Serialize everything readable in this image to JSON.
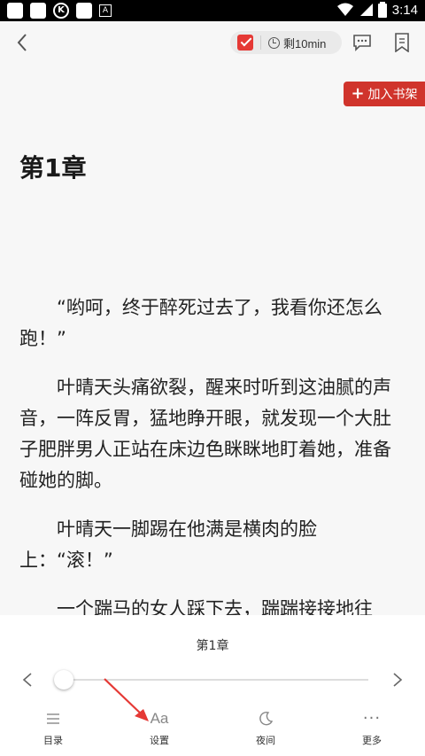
{
  "status_bar": {
    "time": "3:14"
  },
  "top_bar": {
    "timer_text": "剩10min"
  },
  "add_shelf": {
    "label": "加入书架"
  },
  "chapter": {
    "title": "第1章"
  },
  "content": {
    "paragraphs": [
      "“哟呵，终于醉死过去了，我看你还怎么跑！”",
      "叶晴天头痛欲裂，醒来时听到这油腻的声音，一阵反胃，猛地睁开眼，就发现一个大肚子肥胖男人正站在床边色眯眯地盯着她，准备碰她的脚。",
      "叶晴天一脚踢在他满是横肉的脸上：“滚！”",
      "一个踹马的女人踩下去，踹踹接接地往"
    ]
  },
  "panel": {
    "chapter_label": "第1章",
    "progress": 0.0,
    "nav": [
      {
        "label": "目录",
        "icon": "list-icon"
      },
      {
        "label": "设置",
        "icon": "font-settings-icon",
        "glyph": "Aa"
      },
      {
        "label": "夜间",
        "icon": "moon-icon"
      },
      {
        "label": "更多",
        "icon": "more-dots-icon",
        "glyph": "···"
      }
    ]
  },
  "colors": {
    "accent": "#d0342c",
    "annotation_arrow": "#e53935"
  }
}
